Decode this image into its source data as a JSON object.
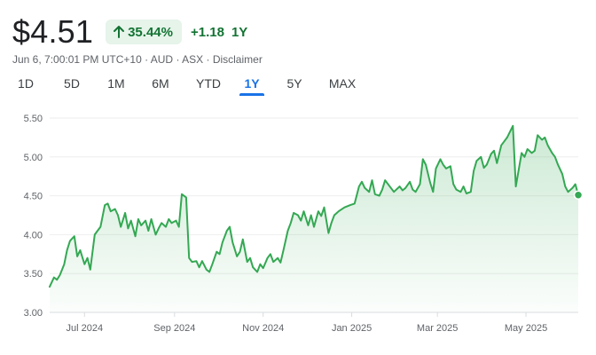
{
  "quote": {
    "price": "$4.51",
    "change_percent": "35.44%",
    "change_abs": "+1.18",
    "period": "1Y",
    "meta_parts": [
      "Jun 6, 7:00:01 PM UTC+10",
      "AUD",
      "ASX",
      "Disclaimer"
    ],
    "meta_separator": " · ",
    "positive_color": "#137333",
    "positive_bg": "#e6f4ea"
  },
  "tabs": [
    {
      "label": "1D",
      "active": false
    },
    {
      "label": "5D",
      "active": false
    },
    {
      "label": "1M",
      "active": false
    },
    {
      "label": "6M",
      "active": false
    },
    {
      "label": "YTD",
      "active": false
    },
    {
      "label": "1Y",
      "active": true
    },
    {
      "label": "5Y",
      "active": false
    },
    {
      "label": "MAX",
      "active": false
    }
  ],
  "chart_data": {
    "type": "area",
    "ylim": [
      3.0,
      5.5
    ],
    "y_ticks": [
      3.0,
      3.5,
      4.0,
      4.5,
      5.0,
      5.5
    ],
    "y_tick_labels": [
      "3.00",
      "3.50",
      "4.00",
      "4.50",
      "5.00",
      "5.50"
    ],
    "x_tick_labels": [
      "Jul 2024",
      "Sep 2024",
      "Nov 2024",
      "Jan 2025",
      "Mar 2025",
      "May 2025"
    ],
    "x_tick_dates": [
      "2024-07-01",
      "2024-09-01",
      "2024-11-01",
      "2025-01-01",
      "2025-03-01",
      "2025-05-01"
    ],
    "x_range": [
      "2024-06-07",
      "2025-06-06"
    ],
    "grid": true,
    "line_color": "#34a853",
    "series": [
      {
        "x": [
          "2024-06-07",
          "2024-06-10",
          "2024-06-12",
          "2024-06-14",
          "2024-06-17",
          "2024-06-19",
          "2024-06-21",
          "2024-06-24",
          "2024-06-26",
          "2024-06-28",
          "2024-07-01",
          "2024-07-03",
          "2024-07-05",
          "2024-07-08",
          "2024-07-10",
          "2024-07-12",
          "2024-07-15",
          "2024-07-17",
          "2024-07-19",
          "2024-07-22",
          "2024-07-24",
          "2024-07-26",
          "2024-07-29",
          "2024-07-31",
          "2024-08-02",
          "2024-08-05",
          "2024-08-07",
          "2024-08-09",
          "2024-08-12",
          "2024-08-14",
          "2024-08-16",
          "2024-08-19",
          "2024-08-21",
          "2024-08-23",
          "2024-08-26",
          "2024-08-28",
          "2024-08-30",
          "2024-09-02",
          "2024-09-04",
          "2024-09-06",
          "2024-09-09",
          "2024-09-11",
          "2024-09-13",
          "2024-09-16",
          "2024-09-18",
          "2024-09-20",
          "2024-09-23",
          "2024-09-25",
          "2024-09-27",
          "2024-09-30",
          "2024-10-02",
          "2024-10-04",
          "2024-10-07",
          "2024-10-09",
          "2024-10-11",
          "2024-10-14",
          "2024-10-16",
          "2024-10-18",
          "2024-10-21",
          "2024-10-23",
          "2024-10-25",
          "2024-10-28",
          "2024-10-30",
          "2024-11-01",
          "2024-11-04",
          "2024-11-06",
          "2024-11-08",
          "2024-11-11",
          "2024-11-13",
          "2024-11-15",
          "2024-11-18",
          "2024-11-20",
          "2024-11-22",
          "2024-11-25",
          "2024-11-27",
          "2024-11-29",
          "2024-12-02",
          "2024-12-04",
          "2024-12-06",
          "2024-12-09",
          "2024-12-11",
          "2024-12-13",
          "2024-12-16",
          "2024-12-18",
          "2024-12-20",
          "2024-12-23",
          "2024-12-27",
          "2024-12-31",
          "2025-01-03",
          "2025-01-06",
          "2025-01-08",
          "2025-01-10",
          "2025-01-13",
          "2025-01-15",
          "2025-01-17",
          "2025-01-20",
          "2025-01-22",
          "2025-01-24",
          "2025-01-28",
          "2025-01-30",
          "2025-02-03",
          "2025-02-05",
          "2025-02-07",
          "2025-02-10",
          "2025-02-12",
          "2025-02-14",
          "2025-02-17",
          "2025-02-19",
          "2025-02-21",
          "2025-02-24",
          "2025-02-26",
          "2025-02-28",
          "2025-03-03",
          "2025-03-05",
          "2025-03-07",
          "2025-03-10",
          "2025-03-12",
          "2025-03-14",
          "2025-03-17",
          "2025-03-19",
          "2025-03-21",
          "2025-03-24",
          "2025-03-26",
          "2025-03-28",
          "2025-03-31",
          "2025-04-02",
          "2025-04-04",
          "2025-04-07",
          "2025-04-09",
          "2025-04-11",
          "2025-04-14",
          "2025-04-16",
          "2025-04-18",
          "2025-04-22",
          "2025-04-24",
          "2025-04-28",
          "2025-04-30",
          "2025-05-02",
          "2025-05-05",
          "2025-05-07",
          "2025-05-09",
          "2025-05-12",
          "2025-05-14",
          "2025-05-16",
          "2025-05-19",
          "2025-05-21",
          "2025-05-23",
          "2025-05-26",
          "2025-05-28",
          "2025-05-30",
          "2025-06-02",
          "2025-06-04",
          "2025-06-06"
        ],
        "values": [
          3.33,
          3.45,
          3.42,
          3.48,
          3.62,
          3.8,
          3.92,
          3.98,
          3.72,
          3.8,
          3.62,
          3.7,
          3.55,
          4.0,
          4.05,
          4.1,
          4.38,
          4.4,
          4.3,
          4.33,
          4.25,
          4.1,
          4.28,
          4.08,
          4.18,
          3.98,
          4.2,
          4.12,
          4.18,
          4.05,
          4.2,
          4.0,
          4.08,
          4.15,
          4.1,
          4.2,
          4.15,
          4.18,
          4.1,
          4.52,
          4.48,
          3.7,
          3.65,
          3.66,
          3.58,
          3.66,
          3.55,
          3.52,
          3.62,
          3.78,
          3.75,
          3.9,
          4.05,
          4.1,
          3.9,
          3.72,
          3.78,
          3.94,
          3.65,
          3.7,
          3.58,
          3.52,
          3.62,
          3.57,
          3.7,
          3.75,
          3.65,
          3.7,
          3.64,
          3.8,
          4.05,
          4.15,
          4.28,
          4.25,
          4.18,
          4.3,
          4.12,
          4.25,
          4.1,
          4.3,
          4.24,
          4.35,
          4.02,
          4.15,
          4.25,
          4.3,
          4.35,
          4.38,
          4.4,
          4.62,
          4.68,
          4.6,
          4.55,
          4.7,
          4.52,
          4.5,
          4.58,
          4.7,
          4.6,
          4.55,
          4.62,
          4.57,
          4.6,
          4.68,
          4.58,
          4.55,
          4.65,
          4.97,
          4.9,
          4.67,
          4.55,
          4.85,
          4.97,
          4.9,
          4.85,
          4.88,
          4.65,
          4.58,
          4.55,
          4.62,
          4.53,
          4.55,
          4.82,
          4.95,
          5.0,
          4.86,
          4.9,
          5.04,
          5.08,
          4.92,
          5.15,
          5.2,
          5.25,
          5.4,
          4.62,
          5.05,
          5.0,
          5.1,
          5.05,
          5.08,
          5.28,
          5.22,
          5.25,
          5.15,
          5.05,
          5.0,
          4.9,
          4.78,
          4.62,
          4.55,
          4.6,
          4.65,
          4.51
        ]
      }
    ]
  }
}
